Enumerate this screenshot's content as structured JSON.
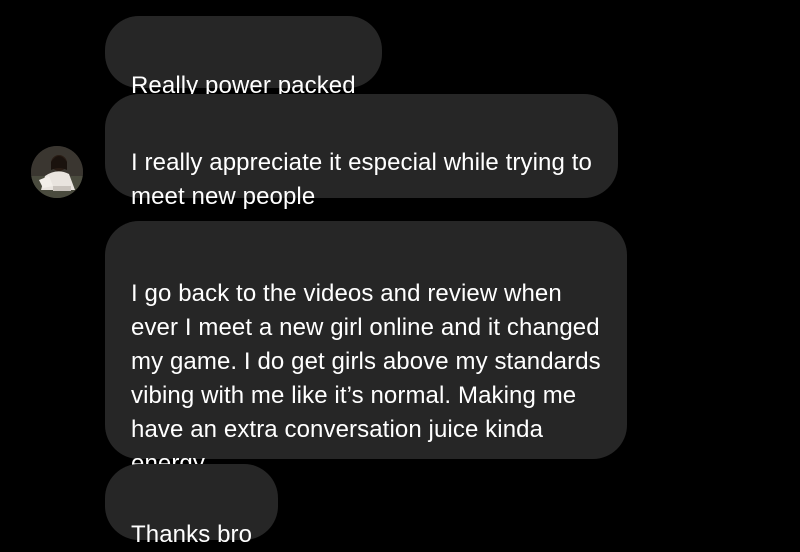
{
  "conversation": {
    "messages": [
      {
        "text": "Really power packed"
      },
      {
        "text": "I really appreciate it especial while trying to\nmeet new people"
      },
      {
        "text": "I go back to the videos and review when\never I meet a new girl online and it changed\nmy game. I do get girls above my standards\nvibing with me like it’s normal. Making me\nhave an extra conversation juice kinda\nenergy"
      },
      {
        "text": "Thanks bro"
      }
    ]
  },
  "colors": {
    "background": "#000000",
    "bubble": "#262626",
    "text": "#ffffff"
  },
  "icons": {
    "avatar": "user-avatar-photo"
  }
}
